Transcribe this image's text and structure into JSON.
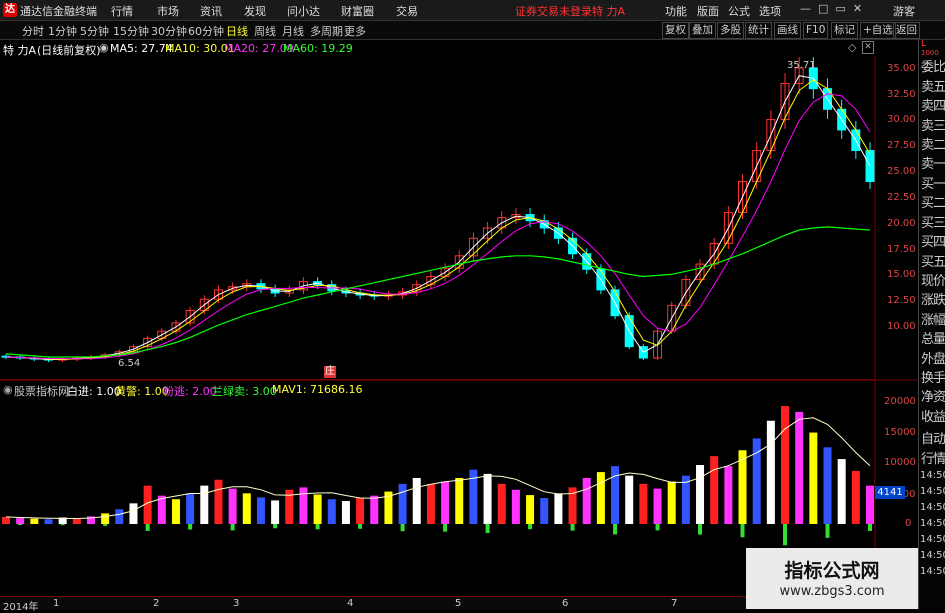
{
  "titlebar": {
    "app_name": "通达信金融终端",
    "menus": [
      "行情",
      "市场",
      "资讯",
      "发现",
      "问小达",
      "财富圈",
      "交易"
    ],
    "trade_status": "证券交易未登录",
    "stock_title": "特 力A",
    "right_menus": [
      "功能",
      "版面",
      "公式",
      "选项"
    ],
    "login": "游客"
  },
  "period_tabs": [
    "分时",
    "1分钟",
    "5分钟",
    "15分钟",
    "30分钟",
    "60分钟",
    "日线",
    "周线",
    "月线",
    "多周期",
    "更多"
  ],
  "period_active": "日线",
  "tools": [
    "复权",
    "叠加",
    "多股",
    "统计",
    "画线",
    "F10",
    "标记",
    "+自选",
    "返回"
  ],
  "info": {
    "stock": "特 力A",
    "mode": "(日线前复权)",
    "ma5": "MA5: 27.74",
    "ma10": "MA10: 30.01",
    "ma20": "MA20: 27.09",
    "ma60": "MA60: 19.29"
  },
  "price_axis": [
    "35.00",
    "32.50",
    "30.00",
    "27.50",
    "25.00",
    "22.50",
    "20.00",
    "17.50",
    "15.00",
    "12.50",
    "10.00"
  ],
  "high_label": "35.71",
  "low_label": "6.54",
  "event_marker": "庄",
  "indicator": {
    "name": "股票指标网",
    "items": [
      "白进: 1.00",
      "黄警: 1.00",
      "粉逃: 2.00",
      "兰绿卖: 3.00",
      "MAV1: 71686.16"
    ]
  },
  "vol_axis": [
    "20000",
    "15000",
    "10000",
    "5000",
    "0"
  ],
  "vol_axis_time": [
    "14:50",
    "14:50",
    "14:50",
    "14:50",
    "14:50",
    "14:50",
    "14:50"
  ],
  "price_tag": "4141",
  "right_panel": [
    "委比",
    "卖五",
    "卖四",
    "卖三",
    "卖二",
    "卖一",
    "买一",
    "买二",
    "买三",
    "买四",
    "买五",
    "现价",
    "涨跌",
    "涨幅",
    "总量",
    "外盘",
    "换手",
    "净资",
    "收益",
    "自动",
    "行情"
  ],
  "x_axis": [
    "2014年",
    "1",
    "2",
    "3",
    "4",
    "5",
    "6",
    "7"
  ],
  "watermark": {
    "title": "指标公式网",
    "url": "www.zbgs3.com"
  },
  "colors": {
    "up": "#ff3333",
    "down": "#00ffff",
    "ma5": "#ffffff",
    "ma10": "#ffff00",
    "ma20": "#ff00ff",
    "ma60": "#00ff00"
  },
  "chart_data": {
    "type": "line",
    "title": "",
    "ylim": [
      6,
      36
    ],
    "candles": [
      7.0,
      6.9,
      6.8,
      6.7,
      6.8,
      6.9,
      7.0,
      7.2,
      7.5,
      8.0,
      8.8,
      9.5,
      10.3,
      11.5,
      12.6,
      13.5,
      13.8,
      14.1,
      13.6,
      13.2,
      13.5,
      14.3,
      14.0,
      13.4,
      13.2,
      13.0,
      12.9,
      13.0,
      13.3,
      14.0,
      14.8,
      15.6,
      16.8,
      18.5,
      19.5,
      20.5,
      20.8,
      20.2,
      19.5,
      18.5,
      17.0,
      15.5,
      13.5,
      11.0,
      8.0,
      6.9,
      9.5,
      12.0,
      14.5,
      16.0,
      18.0,
      21.0,
      24.0,
      27.0,
      30.0,
      33.5,
      35.0,
      33.0,
      31.0,
      29.0,
      27.0,
      24.0
    ],
    "ma60": [
      7.3,
      7.2,
      7.1,
      7.0,
      7.0,
      7.0,
      7.0,
      7.1,
      7.2,
      7.4,
      7.7,
      8.0,
      8.4,
      8.9,
      9.5,
      10.1,
      10.6,
      11.1,
      11.5,
      11.9,
      12.3,
      12.7,
      13.0,
      13.3,
      13.6,
      13.9,
      14.2,
      14.5,
      14.8,
      15.1,
      15.4,
      15.7,
      16.0,
      16.3,
      16.5,
      16.7,
      16.8,
      16.8,
      16.7,
      16.5,
      16.2,
      15.9,
      15.6,
      15.3,
      15.0,
      14.8,
      14.9,
      15.0,
      15.3,
      15.6,
      16.0,
      16.5,
      17.0,
      17.6,
      18.2,
      18.8,
      19.3,
      19.5,
      19.6,
      19.5,
      19.4,
      19.29
    ],
    "volume": [
      1200,
      1000,
      900,
      800,
      1100,
      900,
      1300,
      1800,
      2500,
      3500,
      6500,
      4800,
      4200,
      5200,
      6500,
      7500,
      6000,
      5200,
      4500,
      4000,
      5800,
      6200,
      5000,
      4200,
      3900,
      4500,
      4800,
      5500,
      6800,
      7800,
      6800,
      7200,
      7800,
      9200,
      8500,
      6800,
      5800,
      4900,
      4400,
      5200,
      6200,
      7800,
      8800,
      9800,
      8200,
      6800,
      6000,
      7200,
      8200,
      10000,
      11500,
      9800,
      12500,
      14500,
      17500,
      20000,
      19000,
      15500,
      13000,
      11000,
      9000,
      6500
    ]
  }
}
